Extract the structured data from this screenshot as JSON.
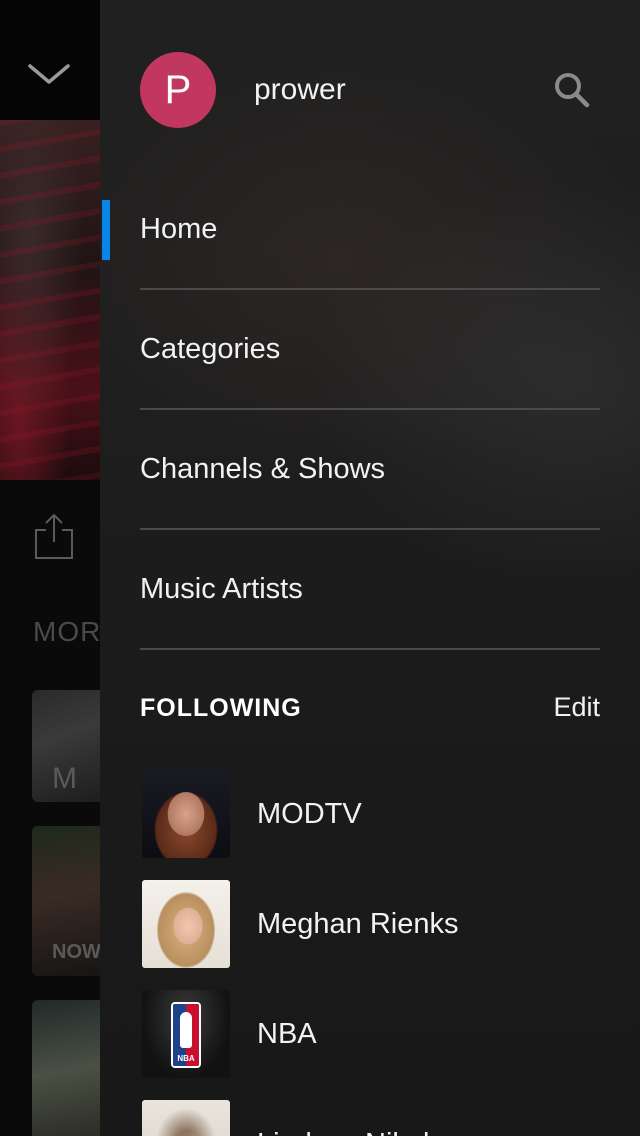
{
  "background": {
    "more_label": "MOR",
    "thumb1_text": "M",
    "thumb2_text": "NOW"
  },
  "profile": {
    "avatar_letter": "P",
    "username": "prower",
    "avatar_color": "#c2375f"
  },
  "nav": {
    "items": [
      {
        "label": "Home",
        "active": true
      },
      {
        "label": "Categories",
        "active": false
      },
      {
        "label": "Channels & Shows",
        "active": false
      },
      {
        "label": "Music Artists",
        "active": false
      }
    ],
    "active_color": "#0a84e6"
  },
  "following": {
    "heading": "FOLLOWING",
    "edit_label": "Edit",
    "items": [
      {
        "name": "MODTV"
      },
      {
        "name": "Meghan Rienks"
      },
      {
        "name": "NBA",
        "logo_text": "NBA"
      },
      {
        "name": "Lindsey Nikole"
      }
    ]
  },
  "icons": {
    "collapse": "chevron-down-icon",
    "share": "share-icon",
    "search": "search-icon"
  }
}
